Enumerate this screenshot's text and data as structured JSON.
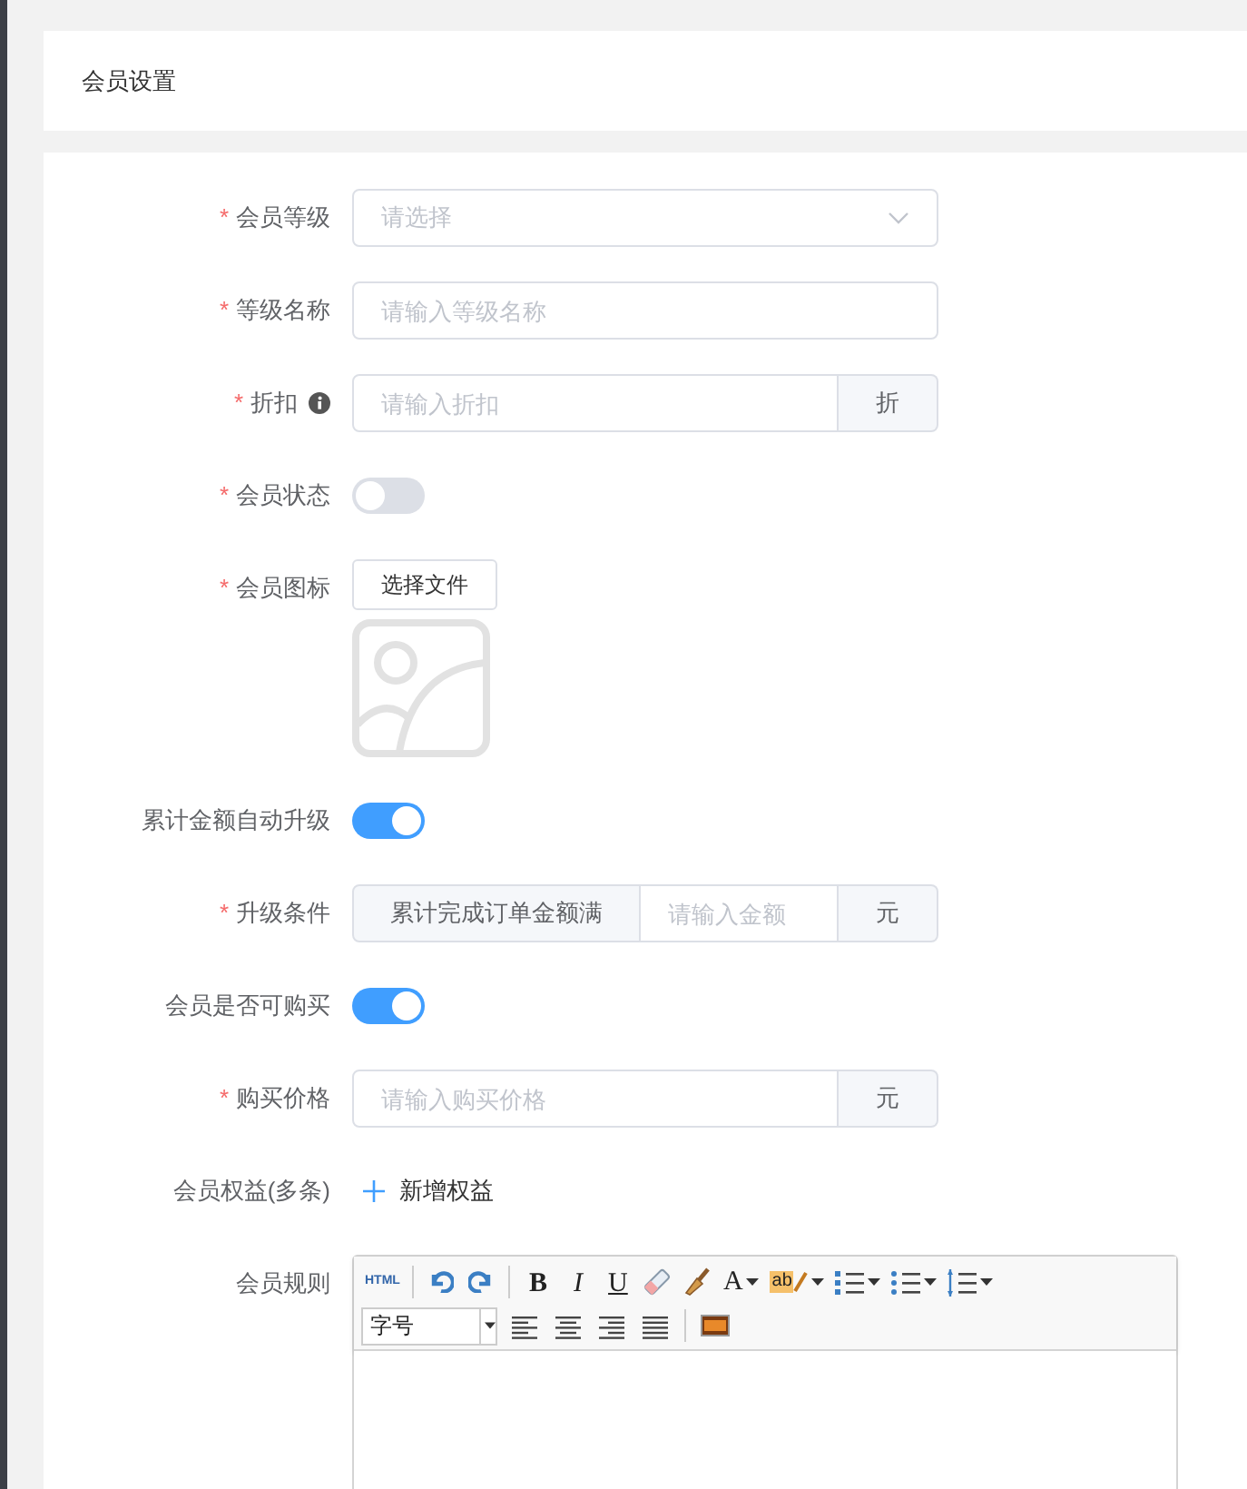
{
  "header": {
    "title": "会员设置"
  },
  "fields": [
    {
      "kind": "select",
      "label": "会员等级",
      "marker": "*",
      "placeholder": "请选择"
    },
    {
      "kind": "text",
      "label": "等级名称",
      "marker": "*",
      "placeholder": "请输入等级名称"
    },
    {
      "kind": "addon",
      "label": "折扣",
      "marker": "*",
      "info": true,
      "placeholder": "请输入折扣",
      "suffix": "折"
    },
    {
      "kind": "switch",
      "label": "会员状态",
      "marker": "*",
      "on": false
    },
    {
      "kind": "file",
      "label": "会员图标",
      "marker": "*",
      "button": "选择文件"
    },
    {
      "kind": "switch",
      "label": "累计金额自动升级",
      "on": true
    },
    {
      "kind": "addon",
      "label": "升级条件",
      "marker": "*",
      "prefix": "累计完成订单金额满",
      "placeholder": "请输入金额",
      "suffix": "元"
    },
    {
      "kind": "switch",
      "label": "会员是否可购买",
      "on": true
    },
    {
      "kind": "addon",
      "label": "购买价格",
      "marker": "*",
      "placeholder": "请输入购买价格",
      "suffix": "元"
    },
    {
      "kind": "link",
      "label": "会员权益(多条)",
      "action": "新增权益"
    },
    {
      "kind": "editor",
      "label": "会员规则",
      "font_size": "字号",
      "toolbar": [
        [
          {
            "kind": "html",
            "text": "HTML"
          },
          {
            "kind": "sep"
          },
          {
            "kind": "undo"
          },
          {
            "kind": "redo"
          },
          {
            "kind": "sep"
          },
          {
            "kind": "bold",
            "text": "B"
          },
          {
            "kind": "italic",
            "text": "I"
          },
          {
            "kind": "underline",
            "text": "U"
          },
          {
            "kind": "eraser"
          },
          {
            "kind": "brush"
          },
          {
            "kind": "font-color",
            "text": "A"
          },
          {
            "kind": "highlight",
            "text": "ab"
          },
          {
            "kind": "ordered-list"
          },
          {
            "kind": "bullet-list"
          },
          {
            "kind": "line-height"
          }
        ],
        [
          {
            "kind": "font-size"
          },
          {
            "kind": "align-left"
          },
          {
            "kind": "align-center"
          },
          {
            "kind": "align-right"
          },
          {
            "kind": "align-justify"
          },
          {
            "kind": "sep"
          },
          {
            "kind": "image"
          }
        ]
      ]
    }
  ]
}
